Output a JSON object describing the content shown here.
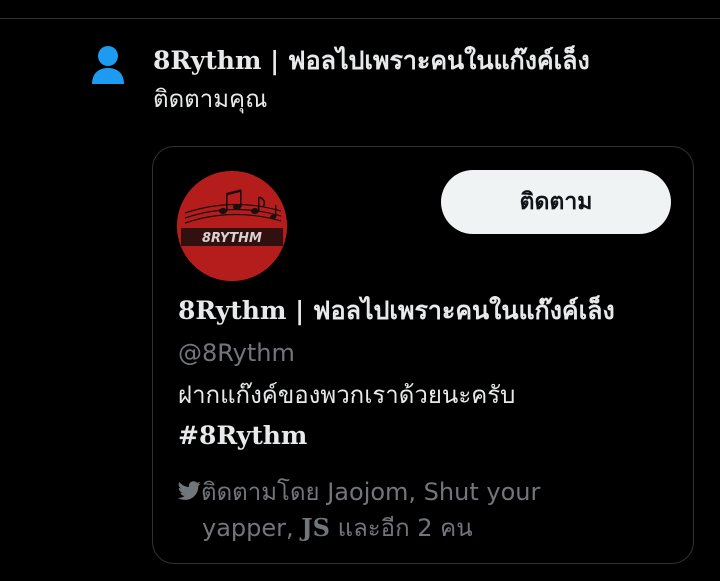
{
  "notification": {
    "icon": "person-icon",
    "icon_color": "#1d9bf0",
    "display_name": "8Rythm | ฟอลไปเพราะคนในแก๊งค์เล็ง",
    "action_text": "ติดตามคุณ"
  },
  "user_card": {
    "avatar": {
      "label": "8RYTHM",
      "background": "#b51d1d"
    },
    "follow_button_label": "ติดตาม",
    "display_name": "8Rythm | ฟอลไปเพราะคนในแก๊งค์เล็ง",
    "handle": "@8Rythm",
    "bio": {
      "text": "ฝากแก๊งค์ของพวกเราด้วยนะครับ",
      "hashtag": "#8Rythm"
    },
    "followed_by": {
      "icon": "twitter-bird-icon",
      "prefix": "ติดตามโดย Jaojom, Shut your",
      "line2_start": "yapper,",
      "bold_name": "JS",
      "suffix": "และอีก 2 คน"
    }
  },
  "colors": {
    "background": "#000000",
    "text_primary": "#e7e9ea",
    "text_secondary": "#71767b",
    "border": "#2f3336",
    "button_bg": "#eff3f4",
    "button_text": "#0f1419",
    "accent_blue": "#1d9bf0"
  }
}
